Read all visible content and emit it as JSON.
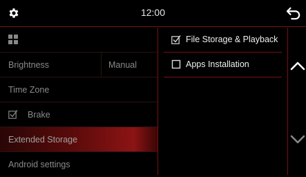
{
  "header": {
    "time": "12:00",
    "settings_icon": "gear-icon",
    "back_icon": "back-arrow-icon"
  },
  "menu": {
    "apps_icon": "grid-icon",
    "brightness_label": "Brightness",
    "brightness_value": "Manual",
    "time_zone_label": "Time Zone",
    "brake_label": "Brake",
    "brake_checked": true,
    "extended_storage_label": "Extended Storage",
    "android_settings_label": "Android settings"
  },
  "options": {
    "file_storage_label": "File Storage & Playback",
    "file_storage_checked": true,
    "apps_installation_label": "Apps Installation",
    "apps_installation_checked": false
  },
  "scroll": {
    "up_icon": "chevron-up-icon",
    "down_icon": "chevron-down-icon"
  },
  "colors": {
    "accent": "#7a1010",
    "selected_highlight": "#8c1414",
    "background": "#000000"
  }
}
